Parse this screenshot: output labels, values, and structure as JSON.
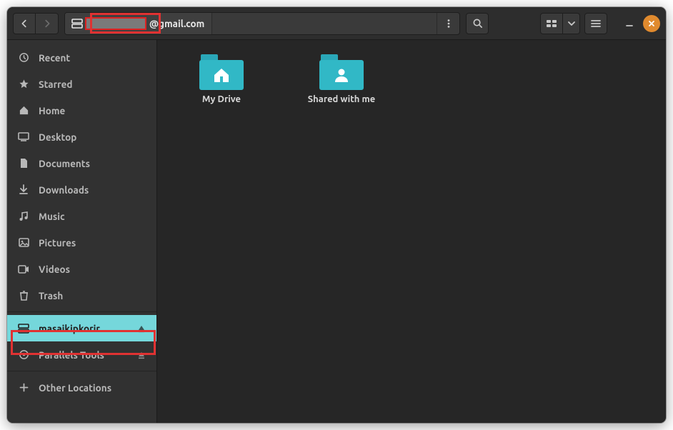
{
  "header": {
    "path_label": "@gmail.com"
  },
  "sidebar": {
    "items": [
      {
        "label": "Recent"
      },
      {
        "label": "Starred"
      },
      {
        "label": "Home"
      },
      {
        "label": "Desktop"
      },
      {
        "label": "Documents"
      },
      {
        "label": "Downloads"
      },
      {
        "label": "Music"
      },
      {
        "label": "Pictures"
      },
      {
        "label": "Videos"
      },
      {
        "label": "Trash"
      }
    ],
    "mounts": [
      {
        "label": "masaikipkorir…",
        "selected": true
      },
      {
        "label": "Parallels Tools",
        "selected": false
      }
    ],
    "other_locations": "Other Locations"
  },
  "content": {
    "items": [
      {
        "label": "My Drive",
        "icon": "home"
      },
      {
        "label": "Shared with me",
        "icon": "person"
      }
    ]
  }
}
